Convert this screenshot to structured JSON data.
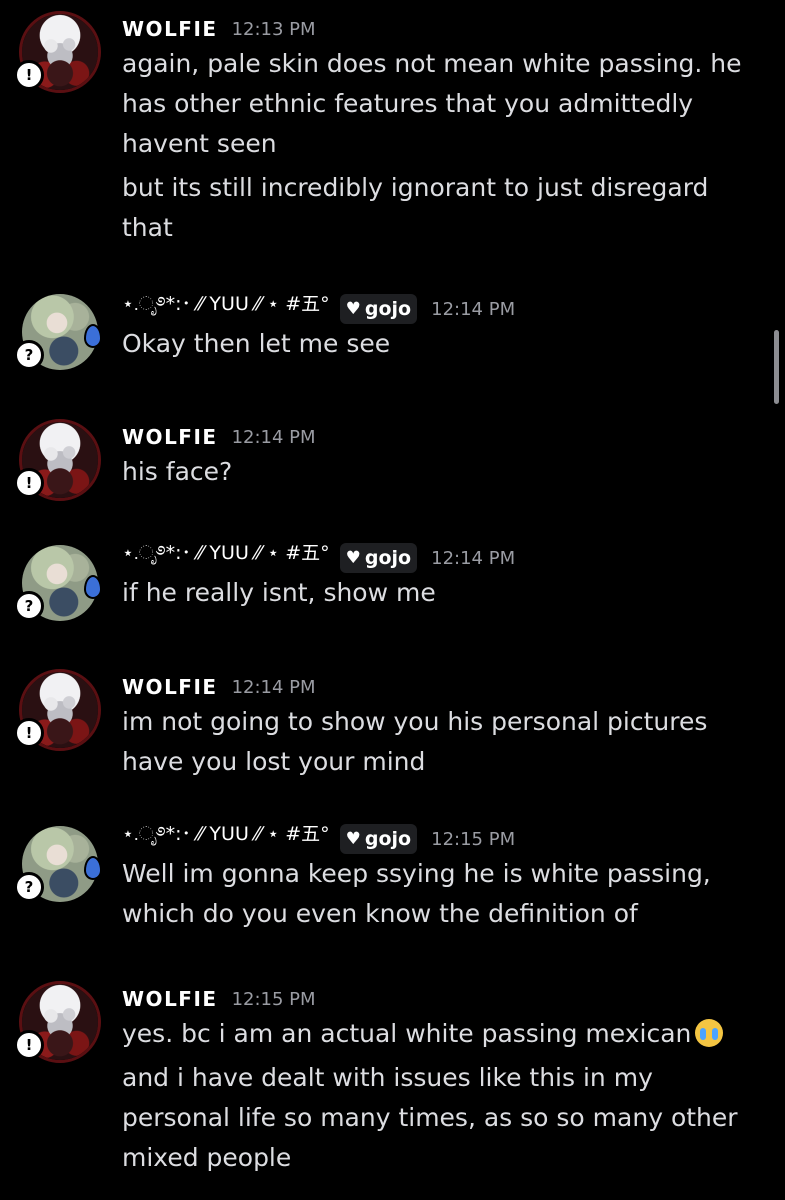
{
  "users": {
    "wolfie": {
      "name": "WOLFIE",
      "avatar_icon": "wolfie-avatar",
      "badge": "!"
    },
    "yuu": {
      "name": "⋆.ೃ࿔*:･ ⁄⁄ YUU ⁄⁄ ⋆ #五°",
      "tag": "gojo",
      "tag_icon": "heart-icon",
      "avatar_icon": "yuu-avatar",
      "badge": "?"
    }
  },
  "messages": [
    {
      "author": "wolfie",
      "time": "12:13 PM",
      "lines": [
        "again, pale skin does not mean white passing. he",
        "has other ethnic features that you admittedly",
        "havent seen"
      ],
      "lines2": [
        "but its still incredibly ignorant to just disregard",
        "that"
      ]
    },
    {
      "author": "yuu",
      "time": "12:14 PM",
      "lines": [
        "Okay then let me see"
      ]
    },
    {
      "author": "wolfie",
      "time": "12:14 PM",
      "lines": [
        "his face?"
      ]
    },
    {
      "author": "yuu",
      "time": "12:14 PM",
      "lines": [
        "if he really isnt, show me"
      ]
    },
    {
      "author": "wolfie",
      "time": "12:14 PM",
      "lines": [
        "im not going to show you his personal pictures",
        "have you lost your mind"
      ]
    },
    {
      "author": "yuu",
      "time": "12:15 PM",
      "lines": [
        "Well im gonna keep ssying he is white passing,",
        "which do you even know the definition of"
      ]
    },
    {
      "author": "wolfie",
      "time": "12:15 PM",
      "lines": [
        "yes. bc i am an actual white passing mexican"
      ],
      "emoji": "loudly-crying-emoji",
      "lines2": [
        "and i have dealt with issues like this in my",
        "personal life so many times, as so so many other",
        "mixed people"
      ]
    }
  ]
}
